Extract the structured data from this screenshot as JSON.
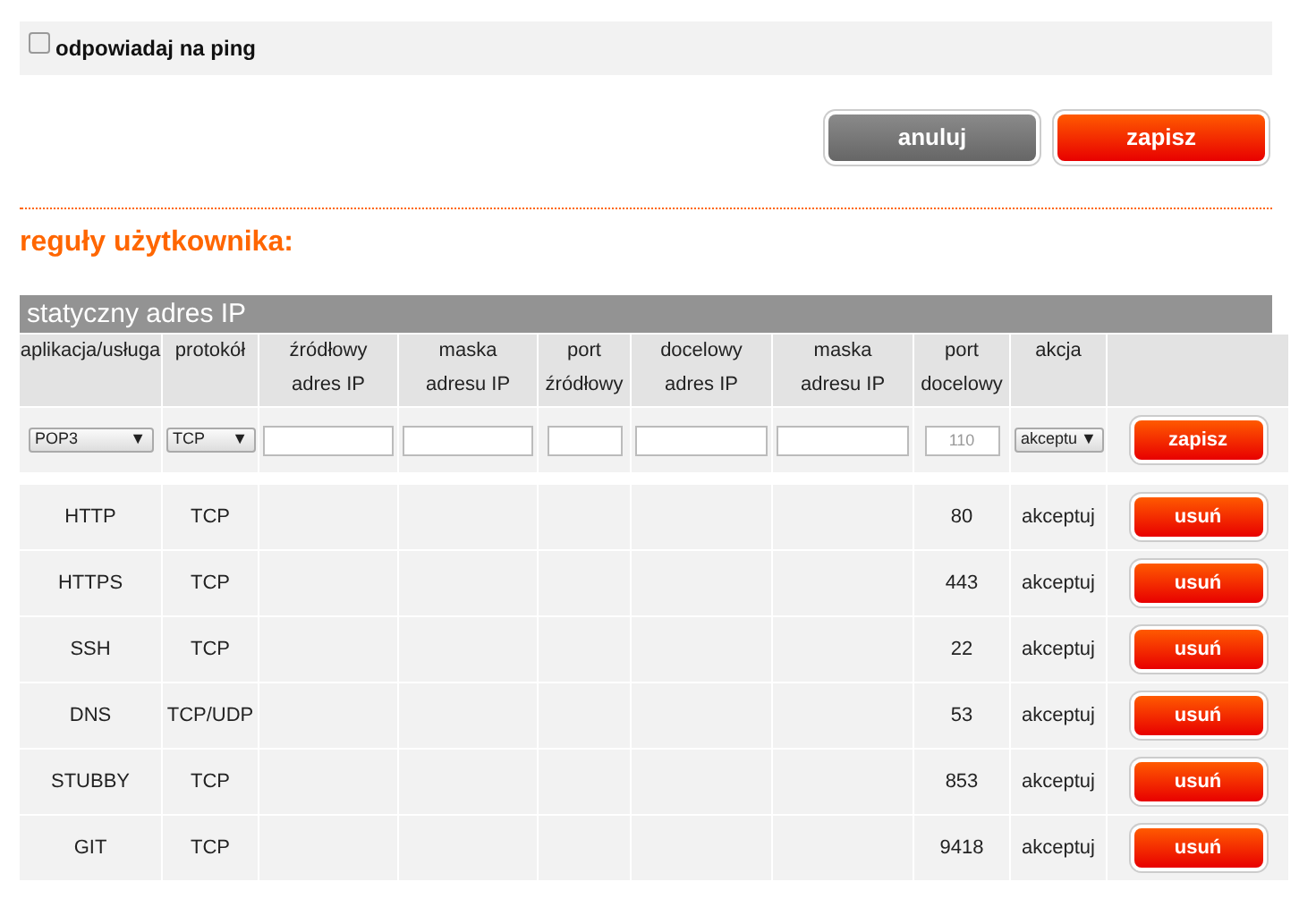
{
  "ping": {
    "label": "odpowiadaj na ping",
    "checked": false
  },
  "actions": [
    "anuluj",
    "zapisz"
  ],
  "section_title": "reguły użytkownika:",
  "table": {
    "title": "statyczny adres IP",
    "columns": [
      [
        "aplikacja/usługa"
      ],
      [
        "protokół"
      ],
      [
        "źródłowy",
        "adres IP"
      ],
      [
        "maska",
        "adresu IP"
      ],
      [
        "port",
        "źródłowy"
      ],
      [
        "docelowy",
        "adres IP"
      ],
      [
        "maska",
        "adresu IP"
      ],
      [
        "port",
        "docelowy"
      ],
      [
        "akcja"
      ],
      []
    ],
    "new_rule": {
      "application": "POP3",
      "protocol": "TCP",
      "dst_port_placeholder": "110",
      "action": "akceptu",
      "caret": "▼",
      "button": "zapisz"
    },
    "rows": [
      {
        "application": "HTTP",
        "protocol": "TCP",
        "dst_port": "80",
        "action": "akceptuj",
        "button": "usuń"
      },
      {
        "application": "HTTPS",
        "protocol": "TCP",
        "dst_port": "443",
        "action": "akceptuj",
        "button": "usuń"
      },
      {
        "application": "SSH",
        "protocol": "TCP",
        "dst_port": "22",
        "action": "akceptuj",
        "button": "usuń"
      },
      {
        "application": "DNS",
        "protocol": "TCP/UDP",
        "dst_port": "53",
        "action": "akceptuj",
        "button": "usuń"
      },
      {
        "application": "STUBBY",
        "protocol": "TCP",
        "dst_port": "853",
        "action": "akceptuj",
        "button": "usuń"
      },
      {
        "application": "GIT",
        "protocol": "TCP",
        "dst_port": "9418",
        "action": "akceptuj",
        "button": "usuń"
      }
    ]
  }
}
